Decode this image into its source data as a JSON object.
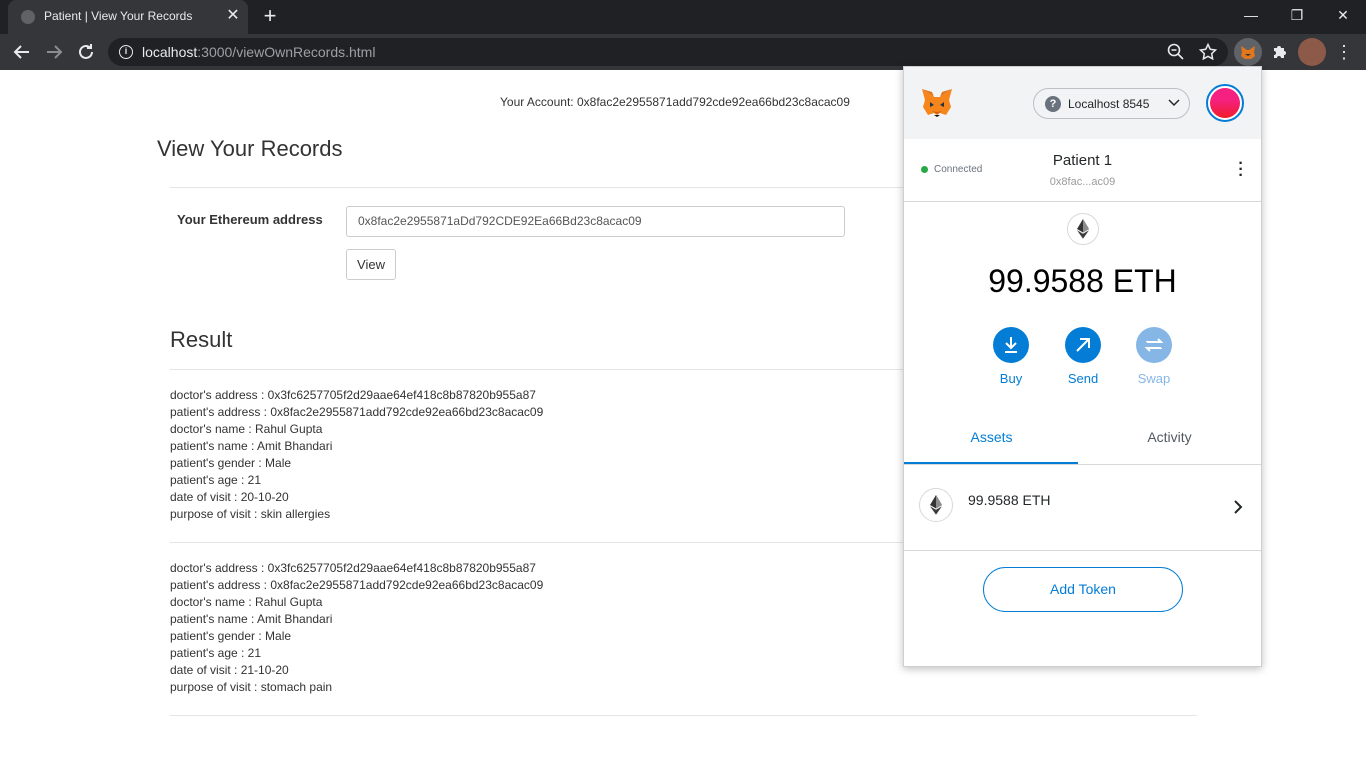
{
  "browser": {
    "tab_title": "Patient | View Your Records",
    "tab_close": "✕",
    "new_tab": "+",
    "url_host": "localhost",
    "url_rest": ":3000/viewOwnRecords.html",
    "window_controls": {
      "minimize": "—",
      "restore": "❐",
      "close": "✕"
    }
  },
  "page": {
    "account_label": "Your Account:",
    "account_address": "0x8fac2e2955871add792cde92ea66bd23c8acac09",
    "title": "View Your Records",
    "form": {
      "label": "Your Ethereum address",
      "input_value": "0x8fac2e2955871aDd792CDE92Ea66Bd23c8acac09",
      "view_button": "View"
    },
    "result_title": "Result",
    "records": [
      {
        "doctor_address": "doctor's address : 0x3fc6257705f2d29aae64ef418c8b87820b955a87",
        "patient_address": "patient's address : 0x8fac2e2955871add792cde92ea66bd23c8acac09",
        "doctor_name": "doctor's name : Rahul Gupta",
        "patient_name": "patient's name : Amit Bhandari",
        "patient_gender": "patient's gender : Male",
        "patient_age": "patient's age : 21",
        "date_of_visit": "date of visit : 20-10-20",
        "purpose": "purpose of visit : skin allergies"
      },
      {
        "doctor_address": "doctor's address : 0x3fc6257705f2d29aae64ef418c8b87820b955a87",
        "patient_address": "patient's address : 0x8fac2e2955871add792cde92ea66bd23c8acac09",
        "doctor_name": "doctor's name : Rahul Gupta",
        "patient_name": "patient's name : Amit Bhandari",
        "patient_gender": "patient's gender : Male",
        "patient_age": "patient's age : 21",
        "date_of_visit": "date of visit : 21-10-20",
        "purpose": "purpose of visit : stomach pain"
      }
    ]
  },
  "metamask": {
    "network": "Localhost 8545",
    "connection_status": "Connected",
    "account_name": "Patient 1",
    "account_short": "0x8fac...ac09",
    "balance": "99.9588 ETH",
    "actions": {
      "buy": "Buy",
      "send": "Send",
      "swap": "Swap"
    },
    "tabs": {
      "assets": "Assets",
      "activity": "Activity"
    },
    "asset_amount": "99.9588 ETH",
    "add_token": "Add Token",
    "accent_color": "#037dd6"
  }
}
